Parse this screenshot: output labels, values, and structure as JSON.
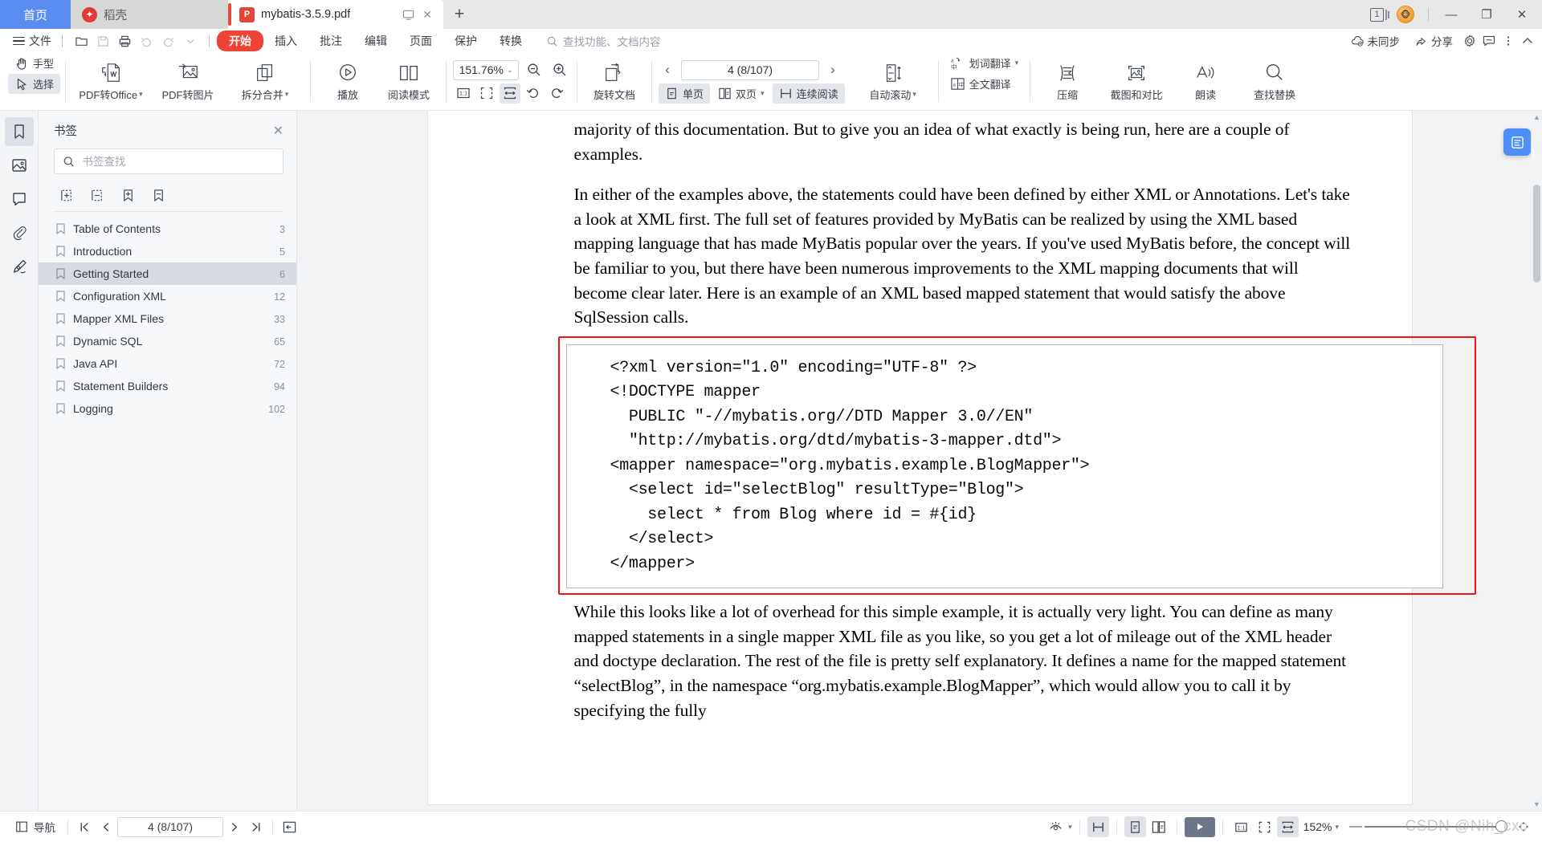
{
  "window": {
    "tabs": [
      {
        "label": "首页",
        "kind": "home"
      },
      {
        "label": "稻壳",
        "kind": "docer"
      },
      {
        "label": "mybatis-3.5.9.pdf",
        "kind": "pdf",
        "active": true
      }
    ],
    "new_tab": "+",
    "window_count": "1",
    "minimize": "—",
    "restore": "❐",
    "close": "✕"
  },
  "menubar": {
    "file_label": "文件",
    "quick_access": [
      "open-folder-icon",
      "save-icon",
      "print-icon",
      "undo-icon",
      "redo-icon",
      "customize-caret-icon"
    ],
    "tabs": [
      {
        "label": "开始",
        "active": true
      },
      {
        "label": "插入",
        "active": false
      },
      {
        "label": "批注",
        "active": false
      },
      {
        "label": "编辑",
        "active": false
      },
      {
        "label": "页面",
        "active": false
      },
      {
        "label": "保护",
        "active": false
      },
      {
        "label": "转换",
        "active": false
      }
    ],
    "search_placeholder": "查找功能、文档内容",
    "right_items": [
      {
        "label": "未同步",
        "icon": "cloud-unsync-icon"
      },
      {
        "label": "分享",
        "icon": "share-icon"
      }
    ],
    "right_icons": [
      "gear-icon",
      "comment-icon",
      "more-icon",
      "collapse-ribbon-icon"
    ]
  },
  "ribbon": {
    "cursor_modes": [
      {
        "label": "手型",
        "icon": "hand-icon",
        "selected": false
      },
      {
        "label": "选择",
        "icon": "pointer-icon",
        "selected": true
      }
    ],
    "convert": [
      {
        "label": "PDF转Office",
        "icon": "pdf-to-office-icon",
        "caret": true
      },
      {
        "label": "PDF转图片",
        "icon": "pdf-to-image-icon",
        "caret": false
      },
      {
        "label": "拆分合并",
        "icon": "split-merge-icon",
        "caret": true
      }
    ],
    "view": [
      {
        "label": "播放",
        "icon": "play-circle-icon"
      },
      {
        "label": "阅读模式",
        "icon": "book-icon"
      }
    ],
    "zoom": {
      "value": "151.76%",
      "zoom_out": "zoom-out-icon",
      "zoom_in": "zoom-in-icon",
      "actual_size": "actual-size-icon",
      "fit_page": "fit-page-icon",
      "fit_width": "fit-width-icon",
      "rotate_left": "rotate-left-icon",
      "rotate_right": "rotate-right-icon",
      "fit_width_selected": true
    },
    "rotate_doc": {
      "label": "旋转文档",
      "icon": "rotate-document-icon"
    },
    "pagination": {
      "value": "4 (8/107)",
      "prev": "‹",
      "next": "›"
    },
    "layouts": [
      {
        "label": "单页",
        "icon": "single-page-icon",
        "selected": true,
        "caret": false
      },
      {
        "label": "双页",
        "icon": "two-page-icon",
        "selected": false,
        "caret": true
      },
      {
        "label": "连续阅读",
        "icon": "continuous-scroll-icon",
        "selected": true,
        "caret": false
      }
    ],
    "autoscroll": {
      "label": "自动滚动",
      "icon": "auto-scroll-icon",
      "caret": true
    },
    "translate": [
      {
        "label": "划词翻译",
        "icon": "word-translate-icon",
        "caret": true
      },
      {
        "label": "全文翻译",
        "icon": "full-translate-icon",
        "caret": false
      }
    ],
    "tools": [
      {
        "label": "压缩",
        "icon": "compress-icon"
      },
      {
        "label": "截图和对比",
        "icon": "screenshot-compare-icon"
      },
      {
        "label": "朗读",
        "icon": "read-aloud-icon"
      },
      {
        "label": "查找替换",
        "icon": "find-replace-icon"
      }
    ]
  },
  "sidebar": {
    "rails": [
      {
        "name": "bookmark",
        "icon": "bookmark-icon",
        "active": true
      },
      {
        "name": "thumbnail",
        "icon": "image-icon",
        "active": false
      },
      {
        "name": "comments",
        "icon": "comment-bubble-icon",
        "active": false
      },
      {
        "name": "attachments",
        "icon": "paperclip-icon",
        "active": false
      },
      {
        "name": "signature",
        "icon": "signature-pen-icon",
        "active": false
      }
    ],
    "panel_title": "书签",
    "close": "✕",
    "search_placeholder": "书签查找",
    "search_value": "",
    "tools": [
      "add-bookmark-box-icon",
      "remove-bookmark-box-icon",
      "add-bookmark-icon",
      "delete-bookmark-icon"
    ],
    "bookmarks": [
      {
        "label": "Table of Contents",
        "page": "3",
        "active": false
      },
      {
        "label": "Introduction",
        "page": "5",
        "active": false
      },
      {
        "label": "Getting Started",
        "page": "6",
        "active": true
      },
      {
        "label": "Configuration XML",
        "page": "12",
        "active": false
      },
      {
        "label": "Mapper XML Files",
        "page": "33",
        "active": false
      },
      {
        "label": "Dynamic SQL",
        "page": "65",
        "active": false
      },
      {
        "label": "Java API",
        "page": "72",
        "active": false
      },
      {
        "label": "Statement Builders",
        "page": "94",
        "active": false
      },
      {
        "label": "Logging",
        "page": "102",
        "active": false
      }
    ]
  },
  "document": {
    "paragraph_1": "majority of this documentation. But to give you an idea of what exactly is being run, here are a couple of examples.",
    "paragraph_2": "In either of the examples above, the statements could have been defined by either XML or Annotations. Let's take a look at XML first. The full set of features provided by MyBatis can be realized by using the XML based mapping language that has made MyBatis popular over the years. If you've used MyBatis before, the concept will be familiar to you, but there have been numerous improvements to the XML mapping documents that will become clear later. Here is an example of an XML based mapped statement that would satisfy the above SqlSession calls.",
    "code_block": "<?xml version=\"1.0\" encoding=\"UTF-8\" ?>\n<!DOCTYPE mapper\n  PUBLIC \"-//mybatis.org//DTD Mapper 3.0//EN\"\n  \"http://mybatis.org/dtd/mybatis-3-mapper.dtd\">\n<mapper namespace=\"org.mybatis.example.BlogMapper\">\n  <select id=\"selectBlog\" resultType=\"Blog\">\n    select * from Blog where id = #{id}\n  </select>\n</mapper>",
    "paragraph_3": "While this looks like a lot of overhead for this simple example, it is actually very light. You can define as many mapped statements in a single mapper XML file as you like, so you get a lot of mileage out of the XML header and doctype declaration. The rest of the file is pretty self explanatory. It defines a name for the mapped statement “selectBlog”, in the namespace “org.mybatis.example.BlogMapper”, which would allow you to call it by specifying the fully",
    "highlight_color": "#f01414",
    "float_button_icon": "doc-tools-icon"
  },
  "statusbar": {
    "nav_label": "导航",
    "nav_icon": "navigation-panel-icon",
    "first_page": "|‹",
    "prev_page": "‹",
    "page_value": "4 (8/107)",
    "next_page": "›",
    "last_page": "›|",
    "back_icon": "back-arrow-icon",
    "eye_icon": "eye-protection-icon",
    "continuous_icon": "continuous-scroll-icon",
    "single_page_icon": "single-page-icon",
    "two_page_icon": "two-page-icon",
    "play_icon": "play-icon",
    "actual_size_icon": "actual-size-icon",
    "fit_page_icon": "fit-page-icon",
    "fit_width_icon": "fit-width-icon",
    "zoom_label": "152%",
    "zoom_minus": "—",
    "fullscreen_icon": "fullscreen-icon",
    "watermark": "CSDN @Nih_cxc"
  }
}
